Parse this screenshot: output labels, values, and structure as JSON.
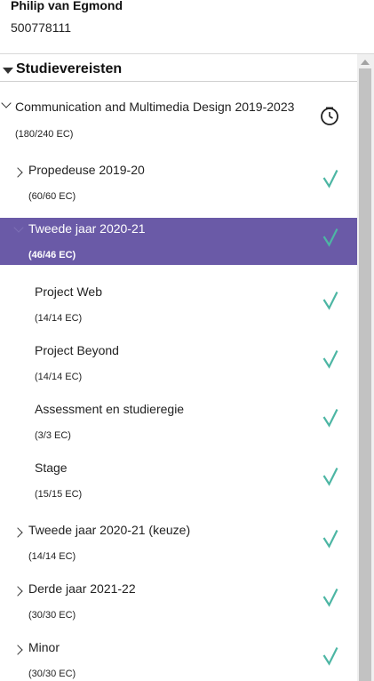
{
  "user": {
    "name": "Philip van Egmond",
    "student_number": "500778111"
  },
  "section": {
    "title": "Studievereisten"
  },
  "program": {
    "title": "Communication and Multimedia Design 2019-2023",
    "ec": "(180/240 EC)",
    "status_icon": "clock-icon"
  },
  "items": [
    {
      "title": "Propedeuse 2019-20",
      "ec": "(60/60 EC)",
      "status_icon": "check-icon"
    },
    {
      "title": "Tweede jaar 2020-21",
      "ec": "(46/46 EC)",
      "status_icon": "check-icon",
      "selected": true
    },
    {
      "title": "Project Web",
      "ec": "(14/14 EC)",
      "status_icon": "check-icon"
    },
    {
      "title": "Project Beyond",
      "ec": "(14/14 EC)",
      "status_icon": "check-icon"
    },
    {
      "title": "Assessment en studieregie",
      "ec": "(3/3 EC)",
      "status_icon": "check-icon"
    },
    {
      "title": "Stage",
      "ec": "(15/15 EC)",
      "status_icon": "check-icon"
    },
    {
      "title": "Tweede jaar 2020-21 (keuze)",
      "ec": "(14/14 EC)",
      "status_icon": "check-icon"
    },
    {
      "title": "Derde jaar 2021-22",
      "ec": "(30/30 EC)",
      "status_icon": "check-icon"
    },
    {
      "title": "Minor",
      "ec": "(30/30 EC)",
      "status_icon": "check-icon"
    }
  ],
  "colors": {
    "selected_bg": "#6a5aa7",
    "check": "#4db6a4",
    "text": "#222222"
  }
}
